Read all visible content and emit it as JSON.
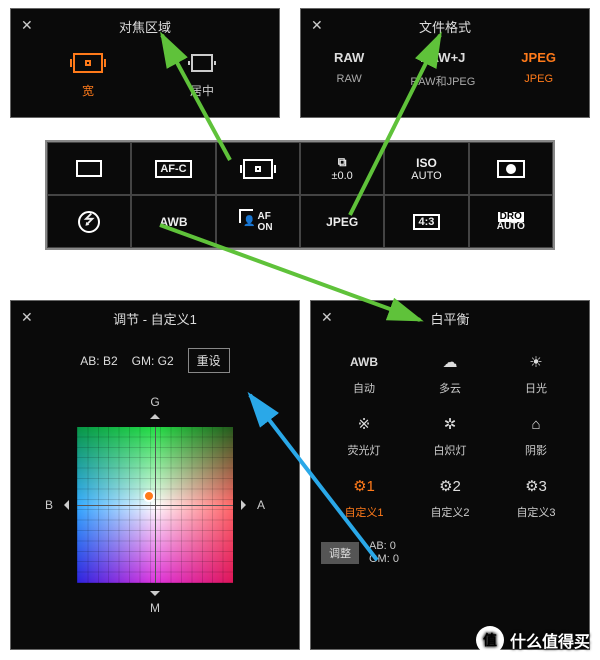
{
  "focus": {
    "title": "对焦区域",
    "close": "✕",
    "options": [
      {
        "label": "宽",
        "selected": true
      },
      {
        "label": "居中",
        "selected": false
      }
    ]
  },
  "format": {
    "title": "文件格式",
    "close": "✕",
    "options": [
      {
        "top": "RAW",
        "bottom": "RAW",
        "selected": false
      },
      {
        "top": "RAW+J",
        "bottom": "RAW和JPEG",
        "selected": false
      },
      {
        "top": "JPEG",
        "bottom": "JPEG",
        "selected": true
      }
    ]
  },
  "strip": {
    "afc": "AF-C",
    "ev_icon": "⧉",
    "ev": "±0.0",
    "iso_top": "ISO",
    "iso_bot": "AUTO",
    "flash": "⭍",
    "awb": "AWB",
    "face_af": "AF",
    "face_on": "ON",
    "jpeg": "JPEG",
    "ratio": "4:3",
    "dro_top": "DRO",
    "dro_bot": "AUTO"
  },
  "custom": {
    "title": "调节 - 自定义1",
    "close": "✕",
    "ab": "AB: B2",
    "gm": "GM: G2",
    "reset": "重设",
    "g": "G",
    "m": "M",
    "a": "A",
    "b": "B"
  },
  "wb": {
    "title": "白平衡",
    "close": "✕",
    "options": [
      {
        "icon": "AWB",
        "label": "自动",
        "bold": true
      },
      {
        "icon": "☁",
        "label": "多云"
      },
      {
        "icon": "☀",
        "label": "日光"
      },
      {
        "icon": "※",
        "label": "荧光灯"
      },
      {
        "icon": "✲",
        "label": "白炽灯"
      },
      {
        "icon": "⌂",
        "label": "阴影"
      },
      {
        "icon": "⚙1",
        "label": "自定义1",
        "selected": true
      },
      {
        "icon": "⚙2",
        "label": "自定义2"
      },
      {
        "icon": "⚙3",
        "label": "自定义3"
      }
    ],
    "adjust": "调整",
    "ab0": "AB: 0",
    "gm0": "GM: 0"
  },
  "watermark": {
    "badge": "值",
    "text": "什么值得买"
  }
}
